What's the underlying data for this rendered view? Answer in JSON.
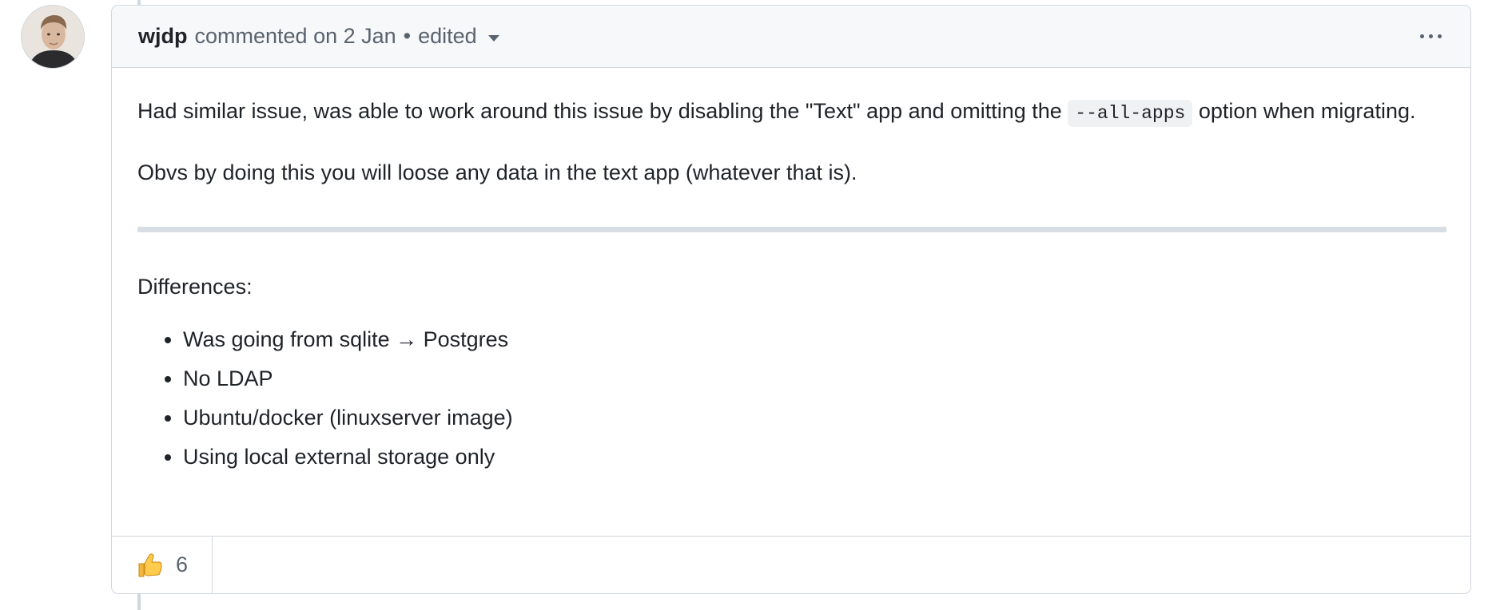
{
  "comment": {
    "author": "wjdp",
    "action": "commented on 2 Jan",
    "separator": "•",
    "edited_label": "edited",
    "body": {
      "p1_before_code": "Had similar issue, was able to work around this issue by disabling the \"Text\" app and omitting the ",
      "p1_code": "--all-apps",
      "p1_after_code": " option when migrating.",
      "p2": "Obvs by doing this you will loose any data in the text app (whatever that is).",
      "differences_title": "Differences:",
      "differences": [
        "Was going from sqlite → Postgres",
        "No LDAP",
        "Ubuntu/docker (linuxserver image)",
        "Using local external storage only"
      ]
    },
    "reactions": [
      {
        "icon": "thumbs-up-icon",
        "count": "6"
      }
    ]
  }
}
